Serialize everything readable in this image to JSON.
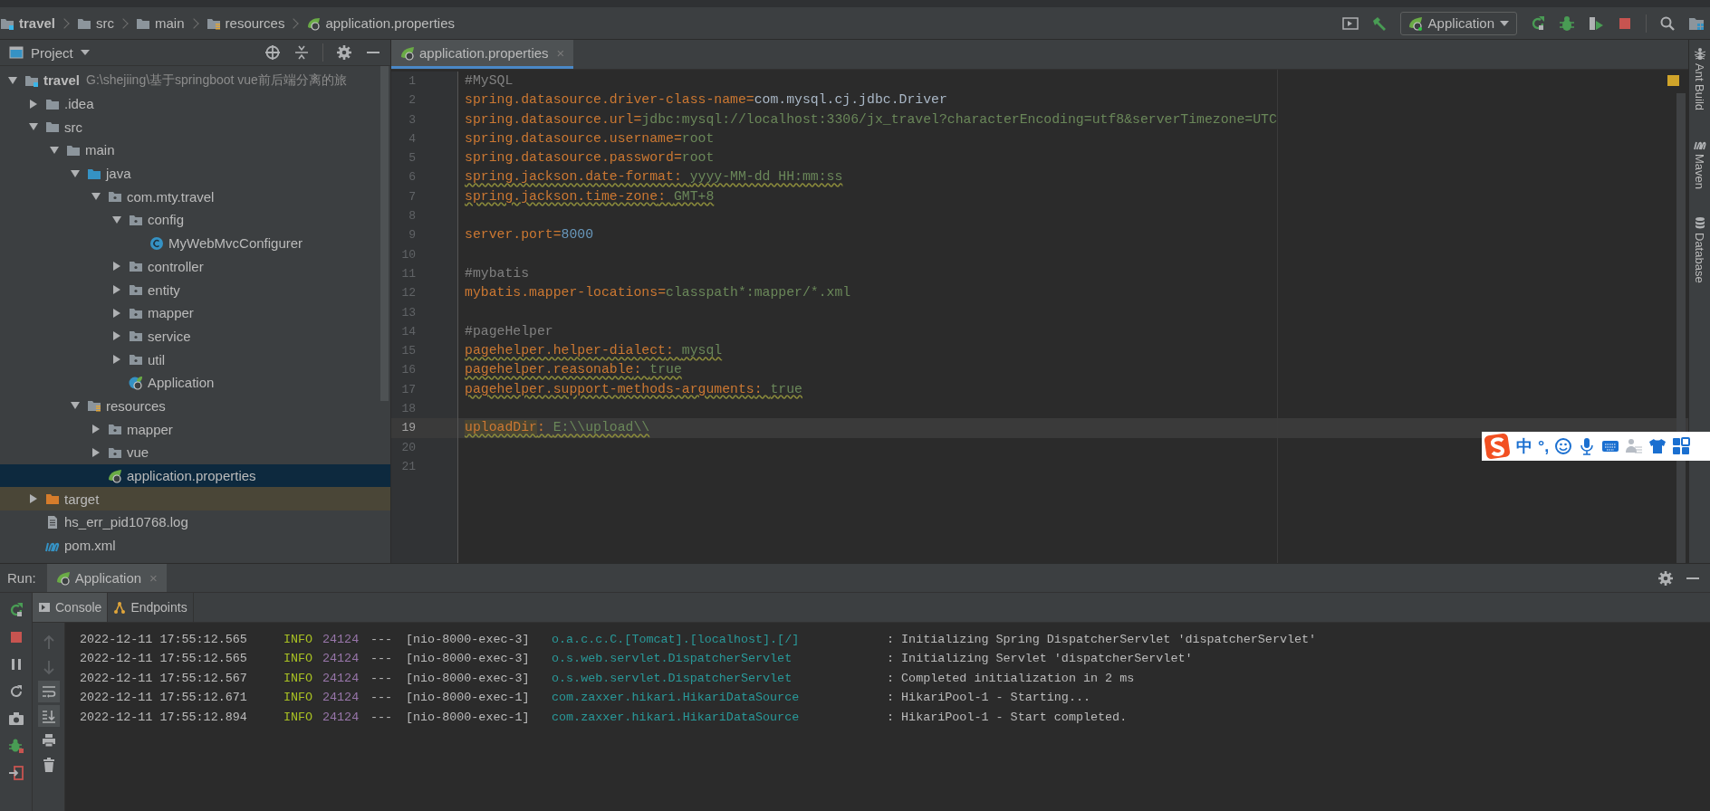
{
  "breadcrumbs": [
    {
      "label": "travel",
      "kind": "module"
    },
    {
      "label": "src",
      "kind": "folder"
    },
    {
      "label": "main",
      "kind": "folder"
    },
    {
      "label": "resources",
      "kind": "resource-root"
    },
    {
      "label": "application.properties",
      "kind": "properties"
    }
  ],
  "run_config": {
    "label": "Application"
  },
  "project_panel": {
    "title": "Project",
    "tree": [
      {
        "label": "travel",
        "kind": "module",
        "path": "G:\\shejiing\\基于springboot vue前后端分离的旅",
        "expanded": true,
        "selected": false,
        "children": [
          {
            "label": ".idea",
            "kind": "folder",
            "expanded": false,
            "selected": false
          },
          {
            "label": "src",
            "kind": "folder",
            "expanded": true,
            "selected": false,
            "children": [
              {
                "label": "main",
                "kind": "folder",
                "expanded": true,
                "selected": false,
                "children": [
                  {
                    "label": "java",
                    "kind": "source-root",
                    "expanded": true,
                    "selected": false,
                    "children": [
                      {
                        "label": "com.mty.travel",
                        "kind": "package",
                        "expanded": true,
                        "selected": false,
                        "children": [
                          {
                            "label": "config",
                            "kind": "package",
                            "expanded": true,
                            "selected": false,
                            "children": [
                              {
                                "label": "MyWebMvcConfigurer",
                                "kind": "class",
                                "selected": false
                              }
                            ]
                          },
                          {
                            "label": "controller",
                            "kind": "package",
                            "expanded": false,
                            "selected": false
                          },
                          {
                            "label": "entity",
                            "kind": "package",
                            "expanded": false,
                            "selected": false
                          },
                          {
                            "label": "mapper",
                            "kind": "package",
                            "expanded": false,
                            "selected": false
                          },
                          {
                            "label": "service",
                            "kind": "package",
                            "expanded": false,
                            "selected": false
                          },
                          {
                            "label": "util",
                            "kind": "package",
                            "expanded": false,
                            "selected": false
                          },
                          {
                            "label": "Application",
                            "kind": "spring-class",
                            "selected": false
                          }
                        ]
                      }
                    ]
                  },
                  {
                    "label": "resources",
                    "kind": "resource-root",
                    "expanded": true,
                    "selected": false,
                    "children": [
                      {
                        "label": "mapper",
                        "kind": "package",
                        "expanded": false,
                        "selected": false
                      },
                      {
                        "label": "vue",
                        "kind": "package",
                        "expanded": false,
                        "selected": false
                      },
                      {
                        "label": "application.properties",
                        "kind": "properties",
                        "selected": true
                      }
                    ]
                  }
                ]
              }
            ]
          },
          {
            "label": "target",
            "kind": "excluded",
            "expanded": false,
            "selected": false
          },
          {
            "label": "hs_err_pid10768.log",
            "kind": "log",
            "selected": false
          },
          {
            "label": "pom.xml",
            "kind": "maven",
            "selected": false
          }
        ]
      }
    ]
  },
  "editor": {
    "tabs": [
      {
        "label": "application.properties",
        "close": "×",
        "selected": true
      }
    ],
    "lines": [
      {
        "number": "1",
        "kind": "comment",
        "text": "#MySQL",
        "warning": false,
        "current": false
      },
      {
        "number": "2",
        "kind": "property",
        "key": "spring.datasource.driver-class-name",
        "sep": "=",
        "value": "com.mysql.cj.jdbc.Driver",
        "color": "#a9b7c6",
        "warning": false,
        "current": false
      },
      {
        "number": "3",
        "kind": "property",
        "key": "spring.datasource.url",
        "sep": "=",
        "value": "jdbc:mysql://localhost:3306/jx_travel?characterEncoding=utf8&serverTimezone=UTC",
        "color": "#6a8759",
        "warning": false,
        "current": false
      },
      {
        "number": "4",
        "kind": "property",
        "key": "spring.datasource.username",
        "sep": "=",
        "value": "root",
        "color": "#6a8759",
        "warning": false,
        "current": false
      },
      {
        "number": "5",
        "kind": "property",
        "key": "spring.datasource.password",
        "sep": "=",
        "value": "root",
        "color": "#6a8759",
        "warning": false,
        "current": false
      },
      {
        "number": "6",
        "kind": "property",
        "key": "spring.jackson.date-format",
        "sep": ": ",
        "value": "yyyy-MM-dd HH:mm:ss",
        "color": "#6a8759",
        "warning": true,
        "current": false
      },
      {
        "number": "7",
        "kind": "property",
        "key": "spring.jackson.time-zone",
        "sep": ": ",
        "value": "GMT+8",
        "color": "#6a8759",
        "warning": true,
        "current": false
      },
      {
        "number": "8",
        "kind": "blank",
        "current": false
      },
      {
        "number": "9",
        "kind": "property",
        "key": "server.port",
        "sep": "=",
        "value": "8000",
        "color": "#6897bb",
        "warning": false,
        "current": false
      },
      {
        "number": "10",
        "kind": "blank",
        "current": false
      },
      {
        "number": "11",
        "kind": "comment",
        "text": "#mybatis",
        "warning": false,
        "current": false
      },
      {
        "number": "12",
        "kind": "property",
        "key": "mybatis.mapper-locations",
        "sep": "=",
        "value": "classpath*:mapper/*.xml",
        "color": "#6a8759",
        "warning": false,
        "current": false
      },
      {
        "number": "13",
        "kind": "blank",
        "current": false
      },
      {
        "number": "14",
        "kind": "comment",
        "text": "#pageHelper",
        "warning": false,
        "current": false
      },
      {
        "number": "15",
        "kind": "property",
        "key": "pagehelper.helper-dialect",
        "sep": ": ",
        "value": "mysql",
        "color": "#6a8759",
        "warning": true,
        "current": false
      },
      {
        "number": "16",
        "kind": "property",
        "key": "pagehelper.reasonable",
        "sep": ": ",
        "value": "true",
        "color": "#6a8759",
        "warning": true,
        "current": false
      },
      {
        "number": "17",
        "kind": "property",
        "key": "pagehelper.support-methods-arguments",
        "sep": ": ",
        "value": "true",
        "color": "#6a8759",
        "warning": true,
        "current": false
      },
      {
        "number": "18",
        "kind": "blank",
        "current": false
      },
      {
        "number": "19",
        "kind": "property",
        "key": "uploadDir",
        "sep": ": ",
        "value": "E:\\\\upload\\\\",
        "color": "#6a8759",
        "warning": true,
        "current": true
      },
      {
        "number": "20",
        "kind": "blank",
        "current": false
      },
      {
        "number": "21",
        "kind": "blank",
        "current": false
      }
    ]
  },
  "right_stripe": [
    {
      "label": "Ant Build",
      "kind": "ant"
    },
    {
      "label": "Maven",
      "kind": "maven"
    },
    {
      "label": "Database",
      "kind": "database"
    }
  ],
  "run_panel": {
    "label": "Run:",
    "tabs": [
      {
        "label": "Application",
        "close": "×",
        "selected": true
      }
    ],
    "subtabs": [
      {
        "label": "Console",
        "kind": "console",
        "selected": true
      },
      {
        "label": "Endpoints",
        "kind": "endpoints",
        "selected": false
      }
    ],
    "console": [
      {
        "date": "2022-12-11 17:55:12.565",
        "level": "INFO",
        "pid": "24124",
        "sep": "---",
        "thread": "[nio-8000-exec-3]",
        "logger": "o.a.c.c.C.[Tomcat].[localhost].[/]",
        "message": ": Initializing Spring DispatcherServlet 'dispatcherServlet'"
      },
      {
        "date": "2022-12-11 17:55:12.565",
        "level": "INFO",
        "pid": "24124",
        "sep": "---",
        "thread": "[nio-8000-exec-3]",
        "logger": "o.s.web.servlet.DispatcherServlet",
        "message": ": Initializing Servlet 'dispatcherServlet'"
      },
      {
        "date": "2022-12-11 17:55:12.567",
        "level": "INFO",
        "pid": "24124",
        "sep": "---",
        "thread": "[nio-8000-exec-3]",
        "logger": "o.s.web.servlet.DispatcherServlet",
        "message": ": Completed initialization in 2 ms"
      },
      {
        "date": "2022-12-11 17:55:12.671",
        "level": "INFO",
        "pid": "24124",
        "sep": "---",
        "thread": "[nio-8000-exec-1]",
        "logger": "com.zaxxer.hikari.HikariDataSource",
        "message": ": HikariPool-1 - Starting..."
      },
      {
        "date": "2022-12-11 17:55:12.894",
        "level": "INFO",
        "pid": "24124",
        "sep": "---",
        "thread": "[nio-8000-exec-1]",
        "logger": "com.zaxxer.hikari.HikariDataSource",
        "message": ": HikariPool-1 - Start completed."
      }
    ]
  },
  "ime_toolbar": {
    "mode": "中",
    "punctuation": "°,"
  }
}
